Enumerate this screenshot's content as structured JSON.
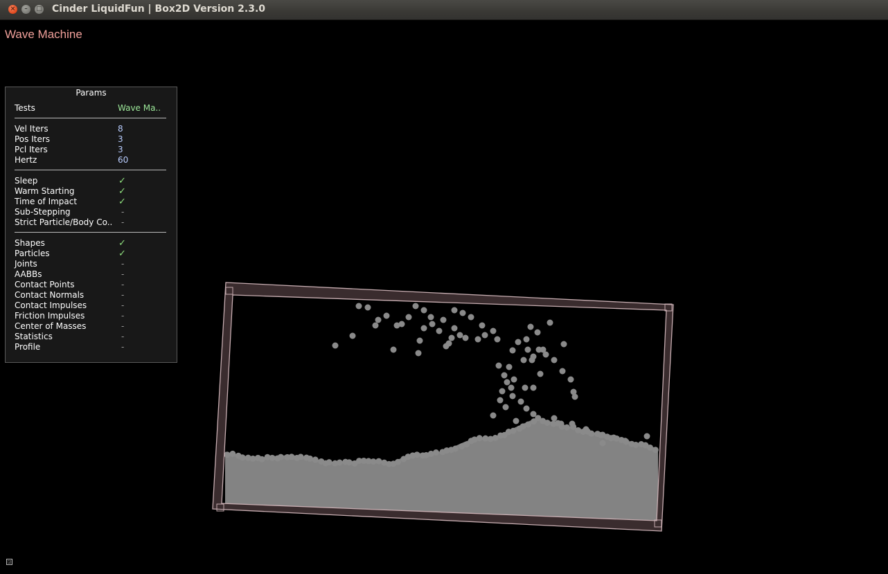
{
  "window": {
    "title": "Cinder LiquidFun | Box2D Version 2.3.0",
    "close_glyph": "×",
    "min_glyph": "–",
    "max_glyph": "□"
  },
  "demo_title": "Wave Machine",
  "params": {
    "header": "Params",
    "tests": {
      "label": "Tests",
      "value": "Wave Ma.."
    },
    "numbers": [
      {
        "label": "Vel Iters",
        "value": "8"
      },
      {
        "label": "Pos Iters",
        "value": "3"
      },
      {
        "label": "Pcl Iters",
        "value": "3"
      },
      {
        "label": "Hertz",
        "value": "60"
      }
    ],
    "flags": [
      {
        "label": "Sleep",
        "on": true
      },
      {
        "label": "Warm Starting",
        "on": true
      },
      {
        "label": "Time of Impact",
        "on": true
      },
      {
        "label": "Sub-Stepping",
        "on": false
      },
      {
        "label": "Strict Particle/Body Co..",
        "on": false
      }
    ],
    "draw": [
      {
        "label": "Shapes",
        "on": true
      },
      {
        "label": "Particles",
        "on": true
      },
      {
        "label": "Joints",
        "on": false
      },
      {
        "label": "AABBs",
        "on": false
      },
      {
        "label": "Contact Points",
        "on": false
      },
      {
        "label": "Contact Normals",
        "on": false
      },
      {
        "label": "Contact Impulses",
        "on": false
      },
      {
        "label": "Friction Impulses",
        "on": false
      },
      {
        "label": "Center of Masses",
        "on": false
      },
      {
        "label": "Statistics",
        "on": false
      },
      {
        "label": "Profile",
        "on": false
      }
    ],
    "check_glyph": "✓",
    "off_glyph": "-"
  },
  "colors": {
    "container_fill": "#3a2c2e",
    "container_edge": "#c8aeb2",
    "particle": "#8a8a8a",
    "label_text": "#ffffff",
    "value_text": "#b9cdff",
    "check": "#8fe07e",
    "demo_title": "#f0a09a"
  }
}
